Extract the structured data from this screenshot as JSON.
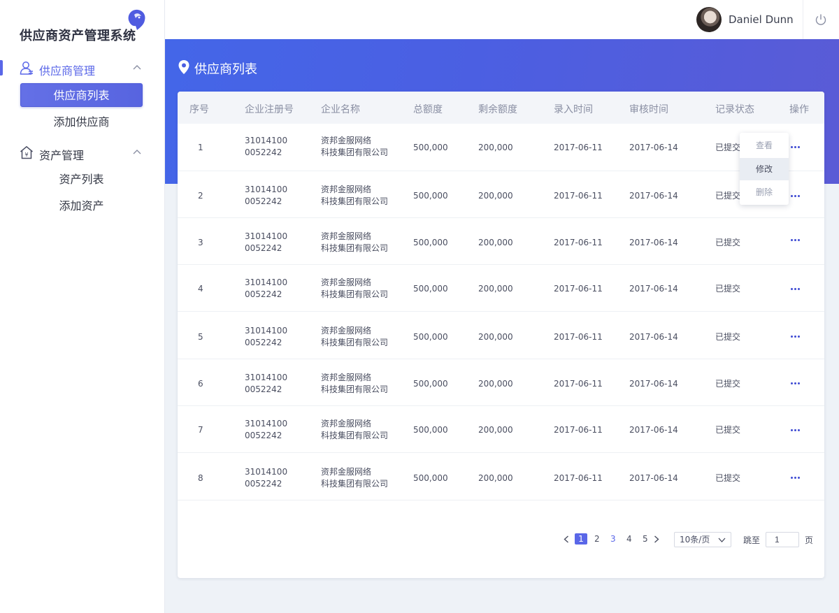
{
  "app": {
    "title": "供应商资产管理系统"
  },
  "sidebar": {
    "groups": [
      {
        "label": "供应商管理",
        "icon": "user-icon",
        "items": [
          {
            "label": "供应商列表",
            "active": true
          },
          {
            "label": "添加供应商",
            "active": false
          }
        ]
      },
      {
        "label": "资产管理",
        "icon": "house-yen-icon",
        "items": [
          {
            "label": "资产列表",
            "active": false
          },
          {
            "label": "添加资产",
            "active": false
          }
        ]
      }
    ]
  },
  "header": {
    "username": "Daniel Dunn"
  },
  "page": {
    "title": "供应商列表"
  },
  "table": {
    "columns": [
      "序号",
      "企业注册号",
      "企业名称",
      "总额度",
      "剩余额度",
      "录入时间",
      "审核时间",
      "记录状态",
      "操作"
    ],
    "rows": [
      {
        "index": "1",
        "reg_line1": "31014100",
        "reg_line2": "0052242",
        "name_line1": "资邦金服网络",
        "name_line2": "科技集团有限公司",
        "total": "500,000",
        "remaining": "200,000",
        "entered": "2017-06-11",
        "reviewed": "2017-06-14",
        "status": "已提交"
      },
      {
        "index": "2",
        "reg_line1": "31014100",
        "reg_line2": "0052242",
        "name_line1": "资邦金服网络",
        "name_line2": "科技集团有限公司",
        "total": "500,000",
        "remaining": "200,000",
        "entered": "2017-06-11",
        "reviewed": "2017-06-14",
        "status": "已提交"
      },
      {
        "index": "3",
        "reg_line1": "31014100",
        "reg_line2": "0052242",
        "name_line1": "资邦金服网络",
        "name_line2": "科技集团有限公司",
        "total": "500,000",
        "remaining": "200,000",
        "entered": "2017-06-11",
        "reviewed": "2017-06-14",
        "status": "已提交"
      },
      {
        "index": "4",
        "reg_line1": "31014100",
        "reg_line2": "0052242",
        "name_line1": "资邦金服网络",
        "name_line2": "科技集团有限公司",
        "total": "500,000",
        "remaining": "200,000",
        "entered": "2017-06-11",
        "reviewed": "2017-06-14",
        "status": "已提交"
      },
      {
        "index": "5",
        "reg_line1": "31014100",
        "reg_line2": "0052242",
        "name_line1": "资邦金服网络",
        "name_line2": "科技集团有限公司",
        "total": "500,000",
        "remaining": "200,000",
        "entered": "2017-06-11",
        "reviewed": "2017-06-14",
        "status": "已提交"
      },
      {
        "index": "6",
        "reg_line1": "31014100",
        "reg_line2": "0052242",
        "name_line1": "资邦金服网络",
        "name_line2": "科技集团有限公司",
        "total": "500,000",
        "remaining": "200,000",
        "entered": "2017-06-11",
        "reviewed": "2017-06-14",
        "status": "已提交"
      },
      {
        "index": "7",
        "reg_line1": "31014100",
        "reg_line2": "0052242",
        "name_line1": "资邦金服网络",
        "name_line2": "科技集团有限公司",
        "total": "500,000",
        "remaining": "200,000",
        "entered": "2017-06-11",
        "reviewed": "2017-06-14",
        "status": "已提交"
      },
      {
        "index": "8",
        "reg_line1": "31014100",
        "reg_line2": "0052242",
        "name_line1": "资邦金服网络",
        "name_line2": "科技集团有限公司",
        "total": "500,000",
        "remaining": "200,000",
        "entered": "2017-06-11",
        "reviewed": "2017-06-14",
        "status": "已提交"
      }
    ]
  },
  "row_menu": {
    "items": [
      "查看",
      "修改",
      "删除"
    ],
    "highlighted": "修改"
  },
  "pagination": {
    "pages": [
      "1",
      "2",
      "3",
      "4",
      "5"
    ],
    "current": "1",
    "page_size": "10条/页",
    "jump_label": "跳至",
    "jump_value": "1",
    "page_suffix": "页"
  },
  "colors": {
    "accent": "#5a67e8",
    "banner_start": "#4466e8",
    "banner_end": "#5a5bd6",
    "background": "#eef2f7"
  }
}
